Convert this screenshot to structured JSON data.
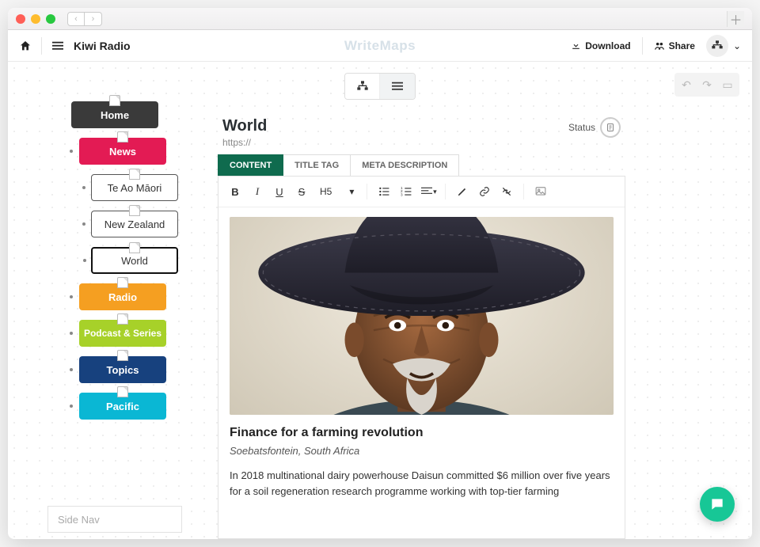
{
  "app": {
    "brand": "WriteMaps",
    "site_name": "Kiwi Radio"
  },
  "topbar": {
    "download_label": "Download",
    "share_label": "Share"
  },
  "tree": {
    "nodes": [
      {
        "id": "home",
        "label": "Home",
        "type": "root"
      },
      {
        "id": "news",
        "label": "News",
        "type": "section"
      },
      {
        "id": "teao",
        "label": "Te Ao Māori",
        "type": "sub"
      },
      {
        "id": "nz",
        "label": "New Zealand",
        "type": "sub"
      },
      {
        "id": "world",
        "label": "World",
        "type": "sub",
        "selected": true
      },
      {
        "id": "radio",
        "label": "Radio",
        "type": "section"
      },
      {
        "id": "podcast",
        "label": "Podcast & Series",
        "type": "section"
      },
      {
        "id": "topics",
        "label": "Topics",
        "type": "section"
      },
      {
        "id": "pacific",
        "label": "Pacific",
        "type": "section"
      }
    ]
  },
  "side_nav_label": "Side Nav",
  "editor": {
    "title": "World",
    "url": "https://",
    "status_label": "Status",
    "tabs": {
      "content": "CONTENT",
      "title_tag": "TITLE TAG",
      "meta_desc": "META DESCRIPTION",
      "active": "content"
    },
    "format": {
      "heading": "H5"
    },
    "article": {
      "headline": "Finance for a farming revolution",
      "location": "Soebatsfontein, South Africa",
      "body": "In 2018 multinational dairy powerhouse Daisun committed $6 million over five years for a soil regeneration research programme working with top-tier farming"
    }
  }
}
